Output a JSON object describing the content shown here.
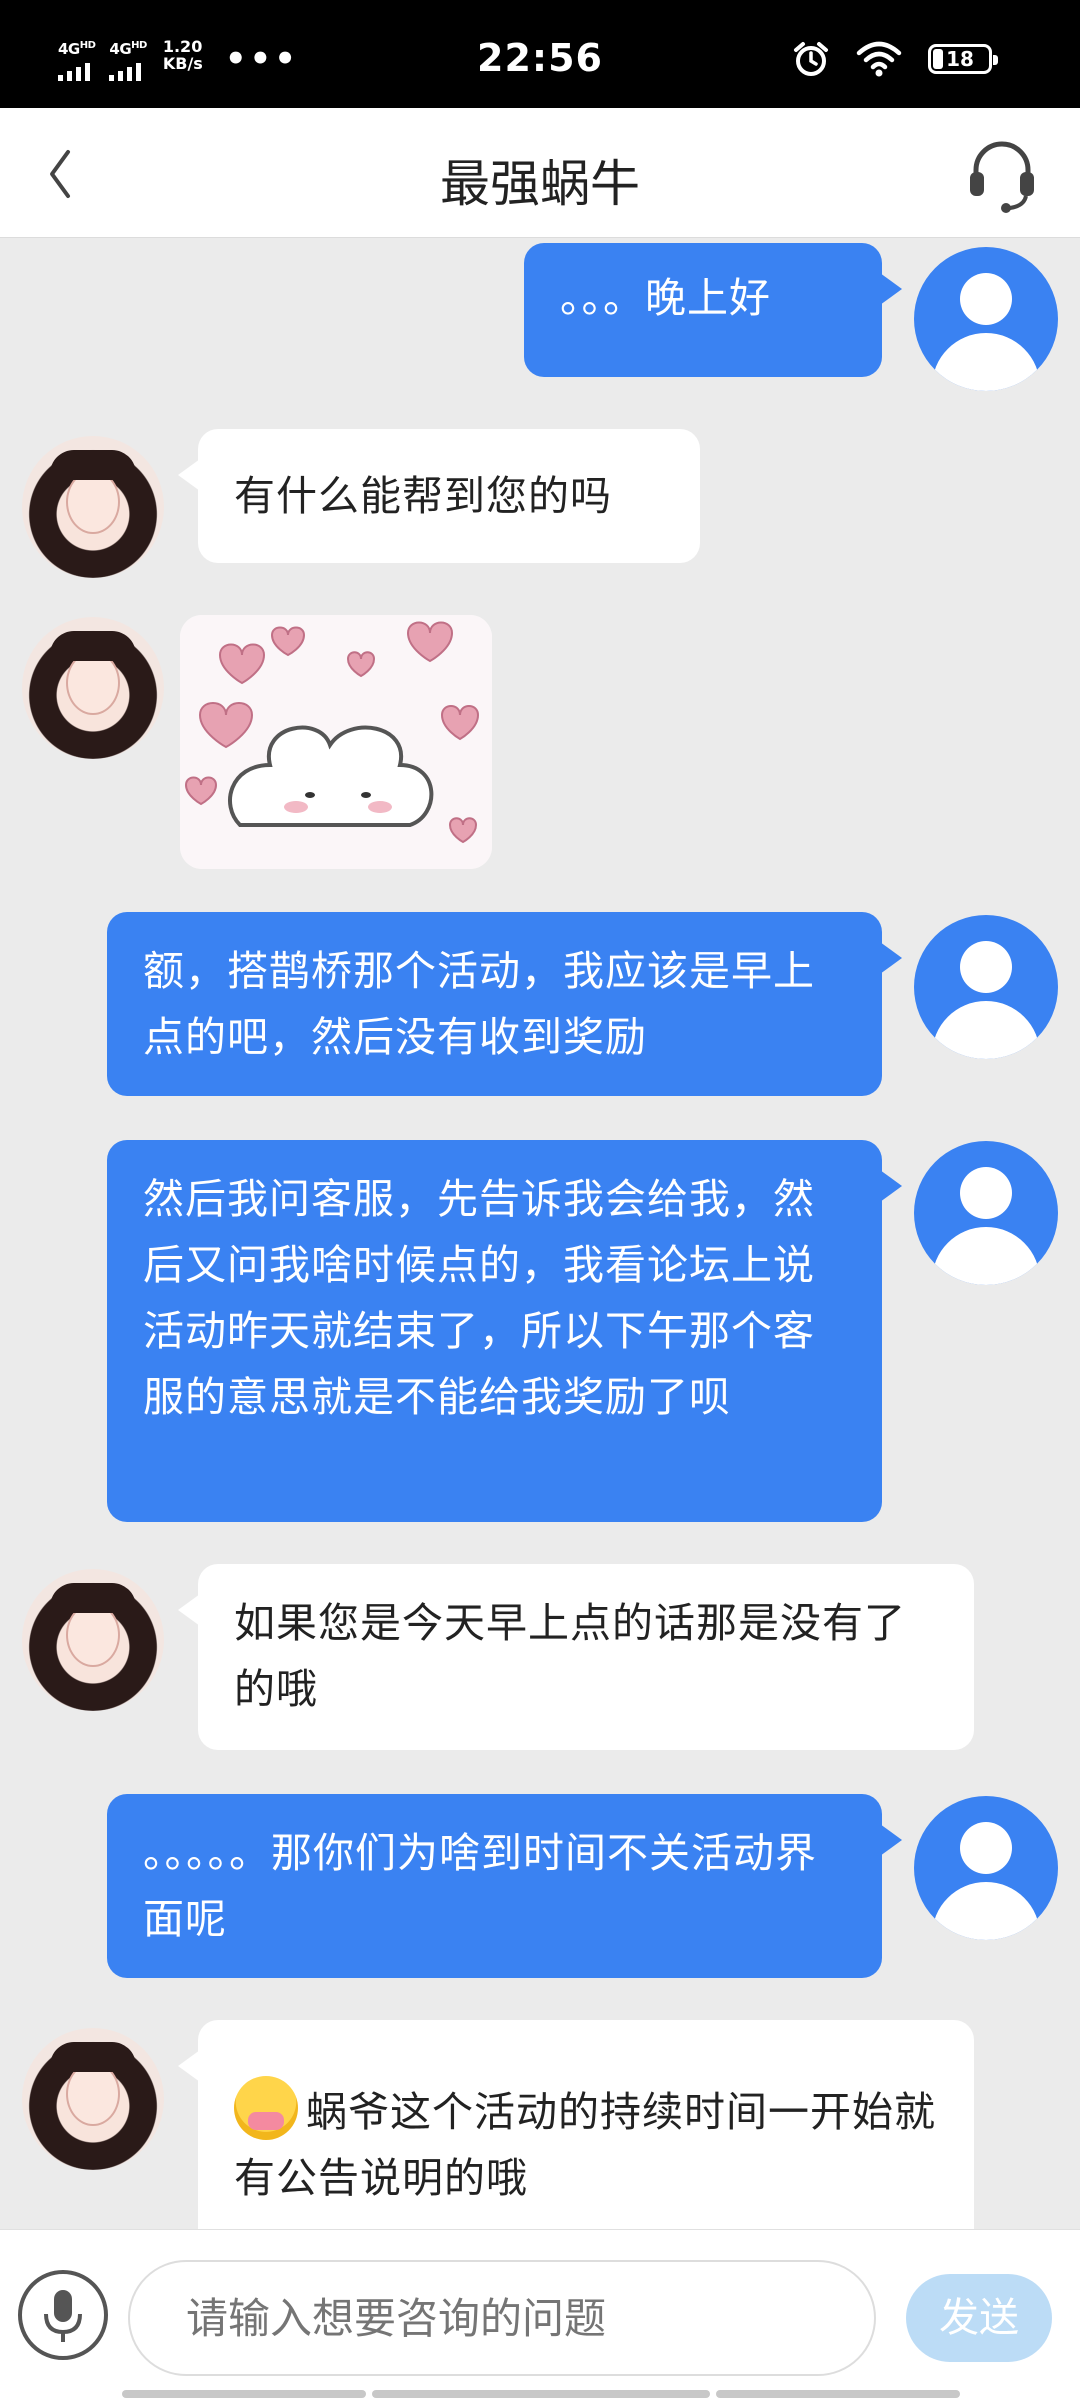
{
  "status_bar": {
    "network1": "4G",
    "network1_hd": "HD",
    "network2": "4G",
    "network2_hd": "HD",
    "speed_value": "1.20",
    "speed_unit": "KB/s",
    "more": "•••",
    "time": "22:56",
    "battery": "18"
  },
  "header": {
    "title": "最强蜗牛",
    "back_icon": "chevron-left-icon",
    "support_icon": "headset-icon"
  },
  "messages": [
    {
      "from": "me",
      "text": "。。。晚上好"
    },
    {
      "from": "agent",
      "text": "有什么能帮到您的吗"
    },
    {
      "from": "agent",
      "type": "sticker",
      "sticker": "heart-bunny-sticker"
    },
    {
      "from": "me",
      "text": "额，搭鹊桥那个活动，我应该是早上点的吧，然后没有收到奖励"
    },
    {
      "from": "me",
      "text": "然后我问客服，先告诉我会给我，然后又问我啥时候点的，我看论坛上说活动昨天就结束了，所以下午那个客服的意思就是不能给我奖励了呗"
    },
    {
      "from": "agent",
      "text": "如果您是今天早上点的话那是没有了的哦"
    },
    {
      "from": "me",
      "text": "。。。。。那你们为啥到时间不关活动界面呢"
    },
    {
      "from": "agent",
      "emoji": "face-with-hand-over-mouth-emoji",
      "text": "蜗爷这个活动的持续时间一开始就有公告说明的哦"
    }
  ],
  "input_bar": {
    "placeholder": "请输入想要咨询的问题",
    "send_label": "发送",
    "mic_icon": "microphone-icon"
  },
  "colors": {
    "my_bubble": "#3a82f2",
    "agent_bubble": "#ffffff",
    "background": "#ebebeb",
    "send_button": "#bcdcf6"
  }
}
